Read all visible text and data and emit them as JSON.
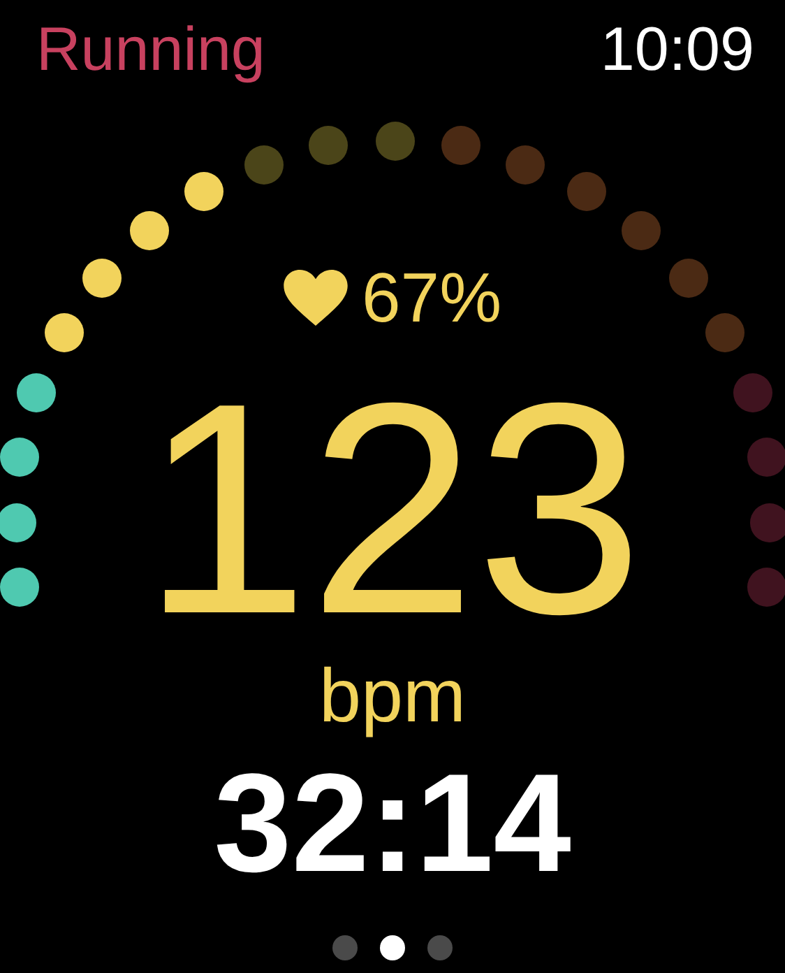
{
  "header": {
    "title": "Running",
    "time": "10:09"
  },
  "zone_dots": [
    {
      "color": "#4fc9b0"
    },
    {
      "color": "#4fc9b0"
    },
    {
      "color": "#4fc9b0"
    },
    {
      "color": "#4fc9b0"
    },
    {
      "color": "#f2d35c"
    },
    {
      "color": "#f2d35c"
    },
    {
      "color": "#f2d35c"
    },
    {
      "color": "#f2d35c"
    },
    {
      "color": "#4b4519"
    },
    {
      "color": "#4b4519"
    },
    {
      "color": "#4b4519"
    },
    {
      "color": "#4b2a14"
    },
    {
      "color": "#4b2a14"
    },
    {
      "color": "#4b2a14"
    },
    {
      "color": "#4b2a14"
    },
    {
      "color": "#4b2a14"
    },
    {
      "color": "#4b2a14"
    },
    {
      "color": "#40131f"
    },
    {
      "color": "#40131f"
    },
    {
      "color": "#40131f"
    },
    {
      "color": "#40131f"
    }
  ],
  "heart_rate": {
    "percent": "67%",
    "value": "123",
    "unit": "bpm"
  },
  "elapsed": "32:14",
  "pages": [
    {
      "selected": false
    },
    {
      "selected": true
    },
    {
      "selected": false
    }
  ]
}
